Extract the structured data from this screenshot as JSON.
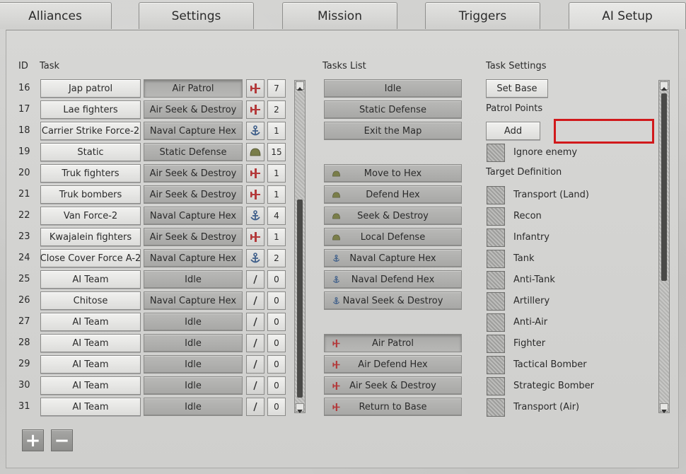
{
  "tabs": [
    {
      "label": "Alliances"
    },
    {
      "label": "Settings"
    },
    {
      "label": "Mission"
    },
    {
      "label": "Triggers"
    },
    {
      "label": "AI Setup"
    }
  ],
  "headers": {
    "id": "ID",
    "task": "Task",
    "tasks_list": "Tasks List",
    "task_settings": "Task Settings"
  },
  "rows": [
    {
      "id": "16",
      "name": "Jap patrol",
      "task": "Air Patrol",
      "icon": "plane-icon",
      "count": "7",
      "selected": true
    },
    {
      "id": "17",
      "name": "Lae fighters",
      "task": "Air Seek & Destroy",
      "icon": "plane-icon",
      "count": "2"
    },
    {
      "id": "18",
      "name": "Carrier Strike Force-2",
      "task": "Naval Capture Hex",
      "icon": "anchor-icon",
      "count": "1"
    },
    {
      "id": "19",
      "name": "Static",
      "task": "Static Defense",
      "icon": "helmet-icon",
      "count": "15"
    },
    {
      "id": "20",
      "name": "Truk fighters",
      "task": "Air Seek & Destroy",
      "icon": "plane-icon",
      "count": "1"
    },
    {
      "id": "21",
      "name": "Truk bombers",
      "task": "Air Seek & Destroy",
      "icon": "plane-icon",
      "count": "1"
    },
    {
      "id": "22",
      "name": "Van Force-2",
      "task": "Naval Capture Hex",
      "icon": "anchor-icon",
      "count": "4"
    },
    {
      "id": "23",
      "name": "Kwajalein fighters",
      "task": "Air Seek & Destroy",
      "icon": "plane-icon",
      "count": "1"
    },
    {
      "id": "24",
      "name": "Close Cover Force A-2",
      "task": "Naval Capture Hex",
      "icon": "anchor-icon",
      "count": "2"
    },
    {
      "id": "25",
      "name": "AI Team",
      "task": "Idle",
      "icon": "slash-icon",
      "count": "0"
    },
    {
      "id": "26",
      "name": "Chitose",
      "task": "Naval Capture Hex",
      "icon": "slash-icon",
      "count": "0"
    },
    {
      "id": "27",
      "name": "AI Team",
      "task": "Idle",
      "icon": "slash-icon",
      "count": "0"
    },
    {
      "id": "28",
      "name": "AI Team",
      "task": "Idle",
      "icon": "slash-icon",
      "count": "0"
    },
    {
      "id": "29",
      "name": "AI Team",
      "task": "Idle",
      "icon": "slash-icon",
      "count": "0"
    },
    {
      "id": "30",
      "name": "AI Team",
      "task": "Idle",
      "icon": "slash-icon",
      "count": "0"
    },
    {
      "id": "31",
      "name": "AI Team",
      "task": "Idle",
      "icon": "slash-icon",
      "count": "0"
    }
  ],
  "tasks_list": {
    "general": [
      "Idle",
      "Static Defense",
      "Exit the Map"
    ],
    "land": [
      "Move to Hex",
      "Defend Hex",
      "Seek & Destroy",
      "Local Defense"
    ],
    "naval": [
      "Naval Capture Hex",
      "Naval Defend Hex",
      "Naval Seek & Destroy"
    ],
    "air": [
      "Air Patrol",
      "Air Defend Hex",
      "Air Seek & Destroy",
      "Return to Base"
    ],
    "selected": "Air Patrol"
  },
  "task_settings": {
    "set_base": "Set Base",
    "patrol_points": "Patrol Points",
    "add": "Add",
    "ignore_enemy": "Ignore enemy",
    "target_definition": "Target Definition",
    "targets": [
      "Transport (Land)",
      "Recon",
      "Infantry",
      "Tank",
      "Anti-Tank",
      "Artillery",
      "Anti-Air",
      "Fighter",
      "Tactical Bomber",
      "Strategic Bomber",
      "Transport (Air)"
    ]
  },
  "bottom": {
    "add_symbol": "+",
    "remove_symbol": "−"
  },
  "colors": {
    "plane": "#b3393a",
    "anchor": "#3f5f8a",
    "helmet": "#7a7e4a",
    "highlight": "#d1191b"
  }
}
